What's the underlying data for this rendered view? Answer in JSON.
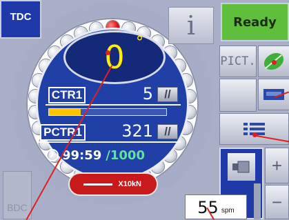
{
  "top_left": {
    "tdc_label": "TDC"
  },
  "info_button": {
    "label": "i"
  },
  "status": {
    "label": "Ready",
    "color": "#5fbf3c"
  },
  "angle": {
    "value": "0",
    "unit": "°"
  },
  "counters": [
    {
      "label": "CTR1",
      "value": "5"
    },
    {
      "label": "PCTR1",
      "value": "321"
    }
  ],
  "progress": {
    "fraction": 0.27,
    "color": "#ffc400"
  },
  "timer": {
    "time": "99:59",
    "count": "/1000"
  },
  "load": {
    "label": "X10kN"
  },
  "side_buttons": {
    "pict_label": "PICT."
  },
  "bottom_left": {
    "bdc_label": "BDC"
  },
  "speed": {
    "value": "55",
    "unit": "spm"
  },
  "icons": [
    "gear-icon",
    "leaf-icon",
    "tray-icon",
    "list-icon",
    "cylinder-icon",
    "plus-icon",
    "minus-icon",
    "clock-icon"
  ]
}
